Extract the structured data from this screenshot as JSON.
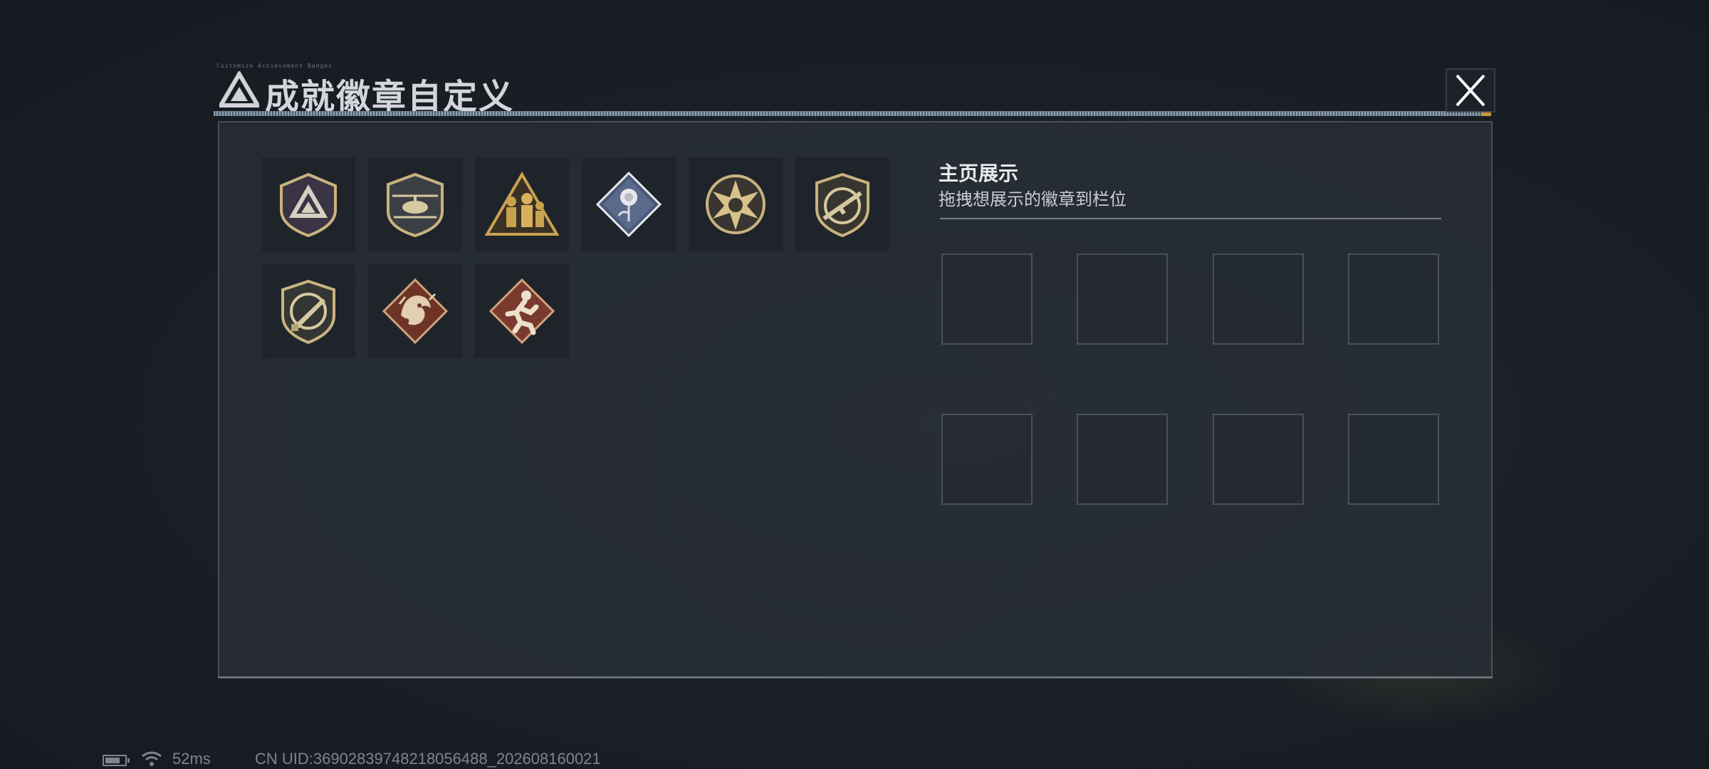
{
  "header": {
    "title": "成就徽章自定义",
    "tiny_caption": "Customize Achievement Badges",
    "close_label": "✕"
  },
  "badges": [
    {
      "name": "delta-triangle-shield",
      "icon": "triangle-logo-icon"
    },
    {
      "name": "helicopter-shield",
      "icon": "helicopter-icon"
    },
    {
      "name": "squad-triangle",
      "icon": "soldiers-icon"
    },
    {
      "name": "rose-diamond",
      "icon": "rose-icon"
    },
    {
      "name": "star-medal",
      "icon": "star-icon"
    },
    {
      "name": "rifle-shield",
      "icon": "rifle-icon"
    },
    {
      "name": "knife-shield",
      "icon": "knife-icon"
    },
    {
      "name": "dragon-diamond",
      "icon": "dragon-icon"
    },
    {
      "name": "runner-diamond",
      "icon": "runner-icon"
    }
  ],
  "showcase": {
    "title": "主页展示",
    "subtitle": "拖拽想展示的徽章到栏位",
    "slot_count": 8
  },
  "status": {
    "ping": "52ms",
    "uid": "CN UID:369028397482180564​88_202608160021"
  },
  "colors": {
    "gold": "#c9b37e",
    "red_badge": "#7a3a2e",
    "blue_badge": "#5a6a8a",
    "panel_bg": "#2a3038"
  }
}
